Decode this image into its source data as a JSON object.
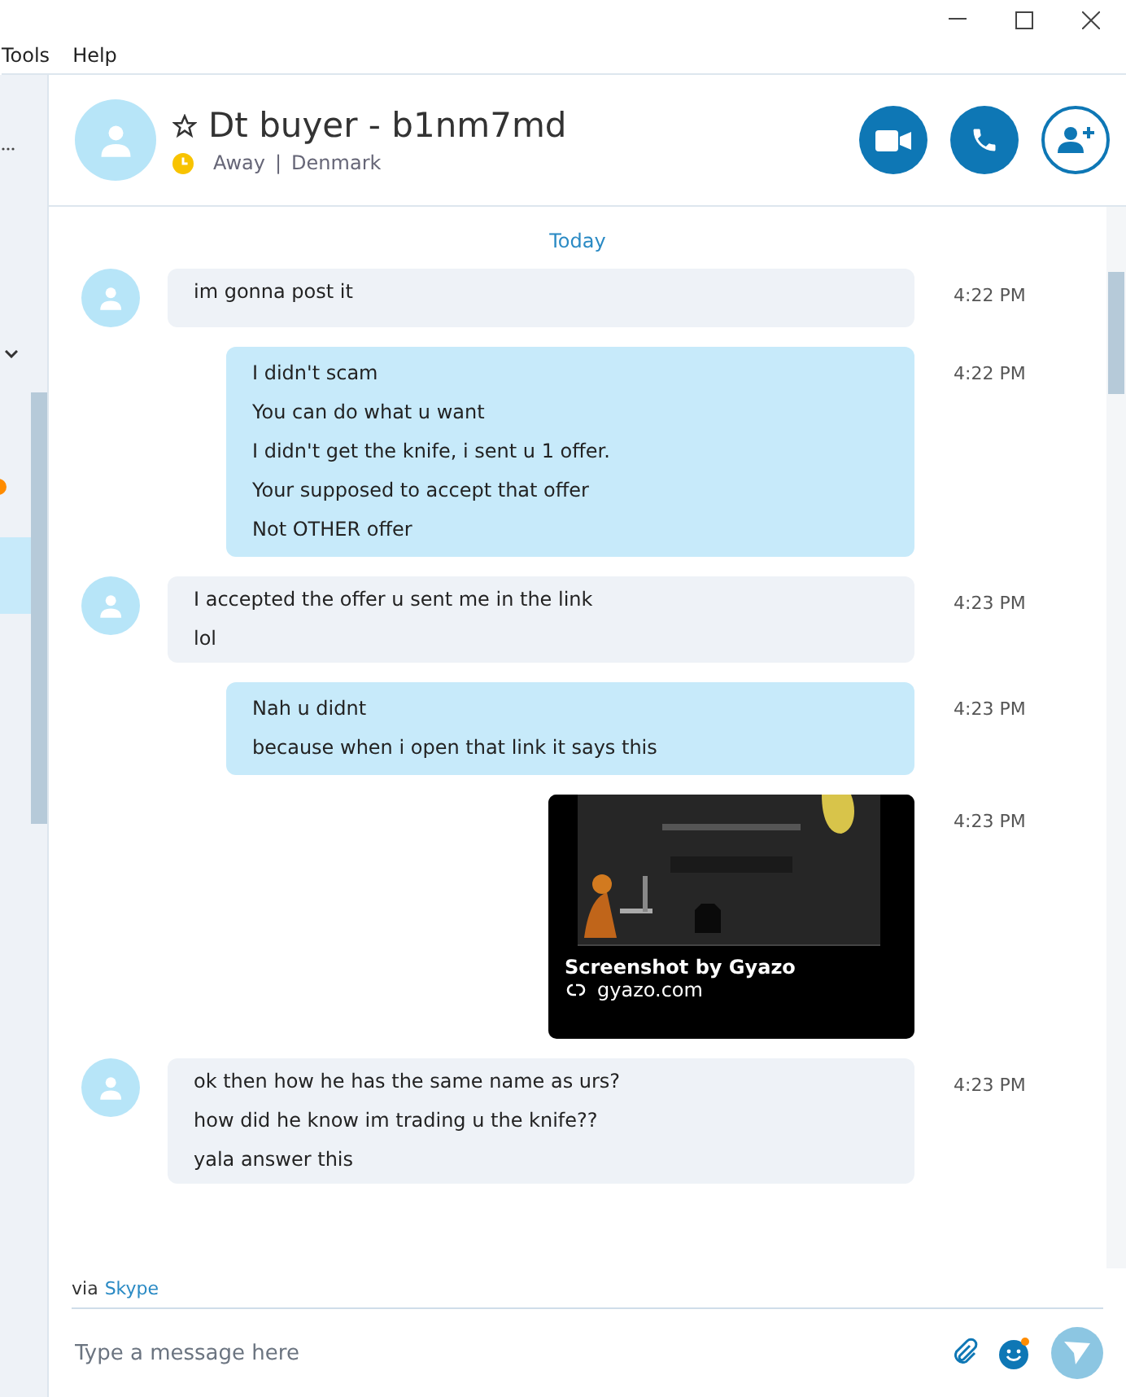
{
  "menu": [
    "Tools",
    "Help"
  ],
  "contact": {
    "name": "Dt buyer - b1nm7md",
    "status": "Away",
    "separator": "|",
    "location": "Denmark",
    "favorite": false
  },
  "day_divider": "Today",
  "messages": [
    {
      "kind": "incoming",
      "lines": [
        "im gonna post it"
      ],
      "time": "4:22 PM"
    },
    {
      "kind": "outgoing",
      "lines": [
        "I didn't scam",
        "You can do what u want",
        "I didn't get the knife, i sent u 1 offer.",
        "Your supposed to accept that offer",
        "Not OTHER offer"
      ],
      "time": "4:22 PM"
    },
    {
      "kind": "incoming",
      "lines": [
        "I accepted the offer u sent me in the link",
        "lol"
      ],
      "time": "4:23 PM"
    },
    {
      "kind": "outgoing",
      "lines": [
        "Nah u didnt",
        "because when i open that link it says this"
      ],
      "time": "4:23 PM"
    },
    {
      "kind": "link",
      "title": "Screenshot by Gyazo",
      "url": "gyazo.com",
      "time": "4:23 PM"
    },
    {
      "kind": "incoming",
      "lines": [
        "ok then how he has the same name as urs?",
        "how did he know im trading u the knife??",
        "yala answer this"
      ],
      "time": "4:23 PM"
    }
  ],
  "via": {
    "prefix": "via",
    "service": "Skype"
  },
  "composer": {
    "placeholder": "Type a message here"
  }
}
